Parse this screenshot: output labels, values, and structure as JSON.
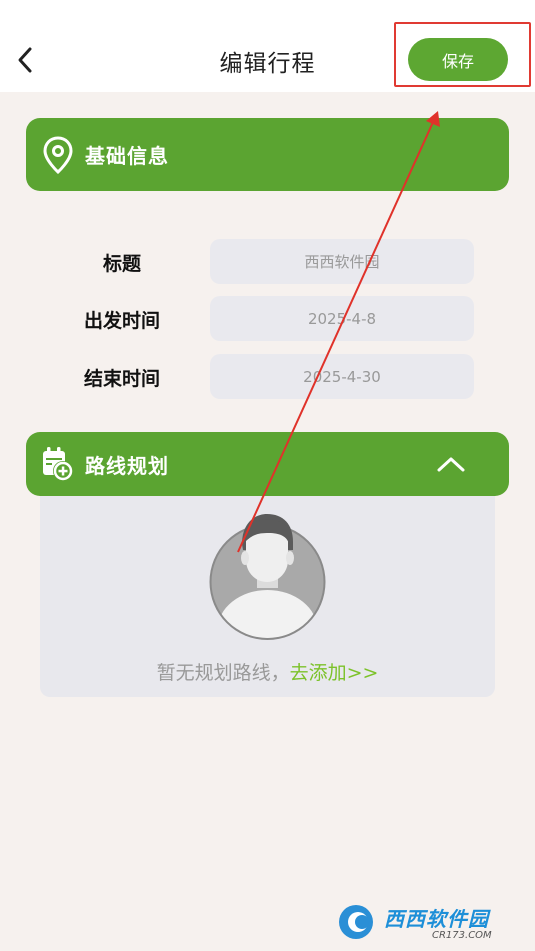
{
  "header": {
    "title": "编辑行程",
    "save_label": "保存",
    "back_icon": "chevron-left-icon"
  },
  "basic_info": {
    "section_title": "基础信息",
    "icon": "location-pin-icon",
    "fields": [
      {
        "label": "标题",
        "value": "西西软件园"
      },
      {
        "label": "出发时间",
        "value": "2025-4-8"
      },
      {
        "label": "结束时间",
        "value": "2025-4-30"
      }
    ]
  },
  "route": {
    "section_title": "路线规划",
    "icon": "calendar-add-icon",
    "collapse_icon": "chevron-up-icon",
    "empty_text": "暂无规划路线，",
    "add_link": "去添加>>"
  },
  "watermark": {
    "name": "西西软件园",
    "domain": "CR173.COM"
  },
  "colors": {
    "accent": "#5ba431",
    "save_button": "#5da732",
    "highlight": "#e03a32",
    "link": "#7cc22a",
    "background": "#f6f1ee"
  }
}
